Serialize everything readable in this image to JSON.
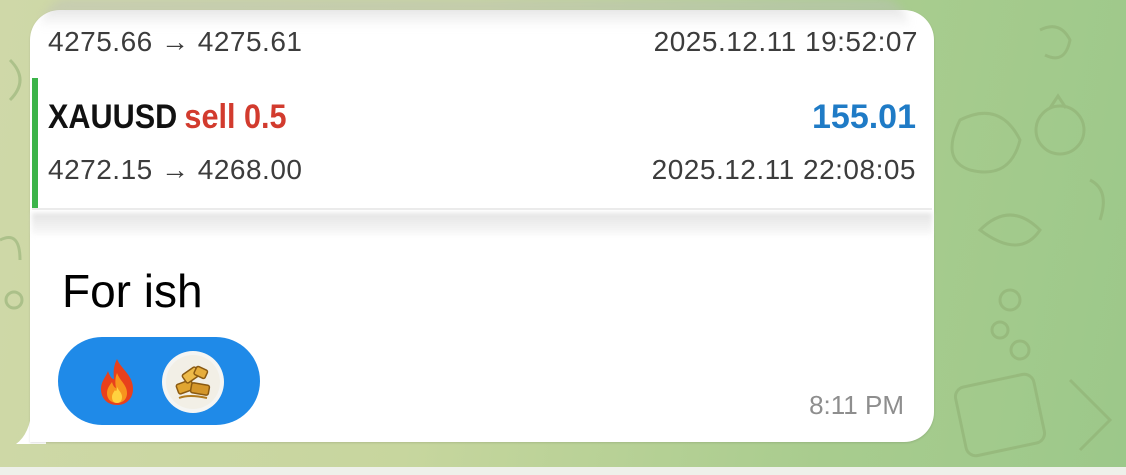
{
  "previous_trade": {
    "prices": "4275.66 → 4275.61",
    "time": "2025.12.11 19:52:07"
  },
  "trade": {
    "symbol": "XAUUSD",
    "side_volume": "sell 0.5",
    "profit": "155.01",
    "prices": "4272.15 → 4268.00",
    "time": "2025.12.11 22:08:05",
    "accent_color": "#3cb44a",
    "sell_color": "#d23b2e",
    "profit_color": "#1f7bc6"
  },
  "message": {
    "text": "For ish",
    "time": "8:11 PM"
  },
  "reactions": [
    {
      "icon": "fire-emoji-icon"
    },
    {
      "icon": "gold-bars-avatar-icon"
    }
  ],
  "colors": {
    "reaction_bg": "#1f8ae8",
    "bubble_bg": "#ffffff"
  }
}
